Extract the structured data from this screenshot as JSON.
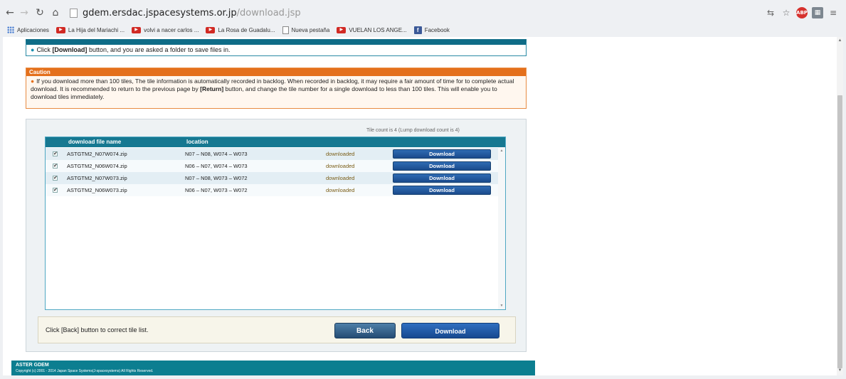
{
  "browser": {
    "url_main": "gdem.ersdac.jspacesystems.or.jp",
    "url_path": "/download.jsp",
    "bookmarks": [
      {
        "label": "Aplicaciones",
        "icon": "apps-grid-icon"
      },
      {
        "label": "La Hija del Mariachi ...",
        "icon": "youtube-icon"
      },
      {
        "label": "volvi a nacer carlos ...",
        "icon": "youtube-icon"
      },
      {
        "label": "La Rosa de Guadalu...",
        "icon": "youtube-icon"
      },
      {
        "label": "Nueva pestaña",
        "icon": "page-icon"
      },
      {
        "label": "VUELAN LOS ANGE...",
        "icon": "youtube-icon"
      },
      {
        "label": "Facebook",
        "icon": "facebook-icon"
      }
    ]
  },
  "download_box": {
    "bullet": "●",
    "text_before": "Click ",
    "text_bold": "[Download]",
    "text_after": " button, and you are asked a folder to save files in."
  },
  "caution": {
    "title": "Caution",
    "bullet": "●",
    "text_1": "If you download more than 100 tiles, The tile information is automatically recorded in backlog. When recorded in backlog, it may require a fair amount of time for to complete actual download. It is recommended to return to the previous page by ",
    "text_bold": "[Return]",
    "text_2": " button, and change the tile number for a single download to less than 100 tiles. This will enable you to download tiles immediately."
  },
  "table": {
    "tile_count": "Tile count is 4 (Lump download count is 4)",
    "headers": {
      "file": "download file name",
      "location": "location"
    },
    "rows": [
      {
        "checked": "✔",
        "file": "ASTGTM2_N07W074.zip",
        "location": "N07 – N08, W074 – W073",
        "status": "downloaded",
        "button": "Download"
      },
      {
        "checked": "✔",
        "file": "ASTGTM2_N06W074.zip",
        "location": "N06 – N07, W074 – W073",
        "status": "downloaded",
        "button": "Download"
      },
      {
        "checked": "✔",
        "file": "ASTGTM2_N07W073.zip",
        "location": "N07 – N08, W073 – W072",
        "status": "downloaded",
        "button": "Download"
      },
      {
        "checked": "✔",
        "file": "ASTGTM2_N06W073.zip",
        "location": "N06 – N07, W073 – W072",
        "status": "downloaded",
        "button": "Download"
      }
    ]
  },
  "bottom": {
    "message": "Click [Back] button to correct tile list.",
    "back_label": "Back",
    "download_label": "Download"
  },
  "footer": {
    "title": "ASTER GDEM",
    "copyright": "Copyright (c) 2001 - 2014 Japan Space Systems(J-spacesystems) All Rights Reserved."
  }
}
